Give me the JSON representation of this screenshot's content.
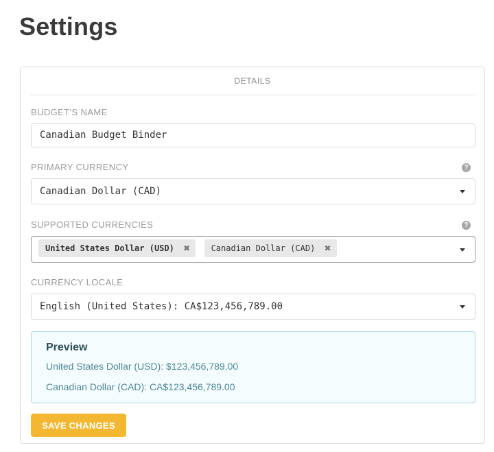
{
  "page": {
    "title": "Settings"
  },
  "card": {
    "header": "DETAILS"
  },
  "budget_name": {
    "label": "BUDGET'S NAME",
    "value": "Canadian Budget Binder"
  },
  "primary_currency": {
    "label": "PRIMARY CURRENCY",
    "selected": "Canadian Dollar (CAD)"
  },
  "supported_currencies": {
    "label": "SUPPORTED CURRENCIES",
    "chips": [
      {
        "label": "United States Dollar (USD)"
      },
      {
        "label": "Canadian Dollar (CAD)"
      }
    ]
  },
  "currency_locale": {
    "label": "CURRENCY LOCALE",
    "selected": "English (United States): CA$123,456,789.00"
  },
  "preview": {
    "title": "Preview",
    "lines": [
      "United States Dollar (USD): $123,456,789.00",
      "Canadian Dollar (CAD): CA$123,456,789.00"
    ]
  },
  "actions": {
    "save_label": "SAVE CHANGES"
  },
  "icons": {
    "help": "help-circle-icon",
    "remove": "close-icon",
    "dropdown": "chevron-down-icon"
  },
  "colors": {
    "accent": "#f4b731",
    "preview_bg": "#f4fcfd",
    "preview_border": "#a9d6de",
    "preview_text": "#4f8797"
  }
}
